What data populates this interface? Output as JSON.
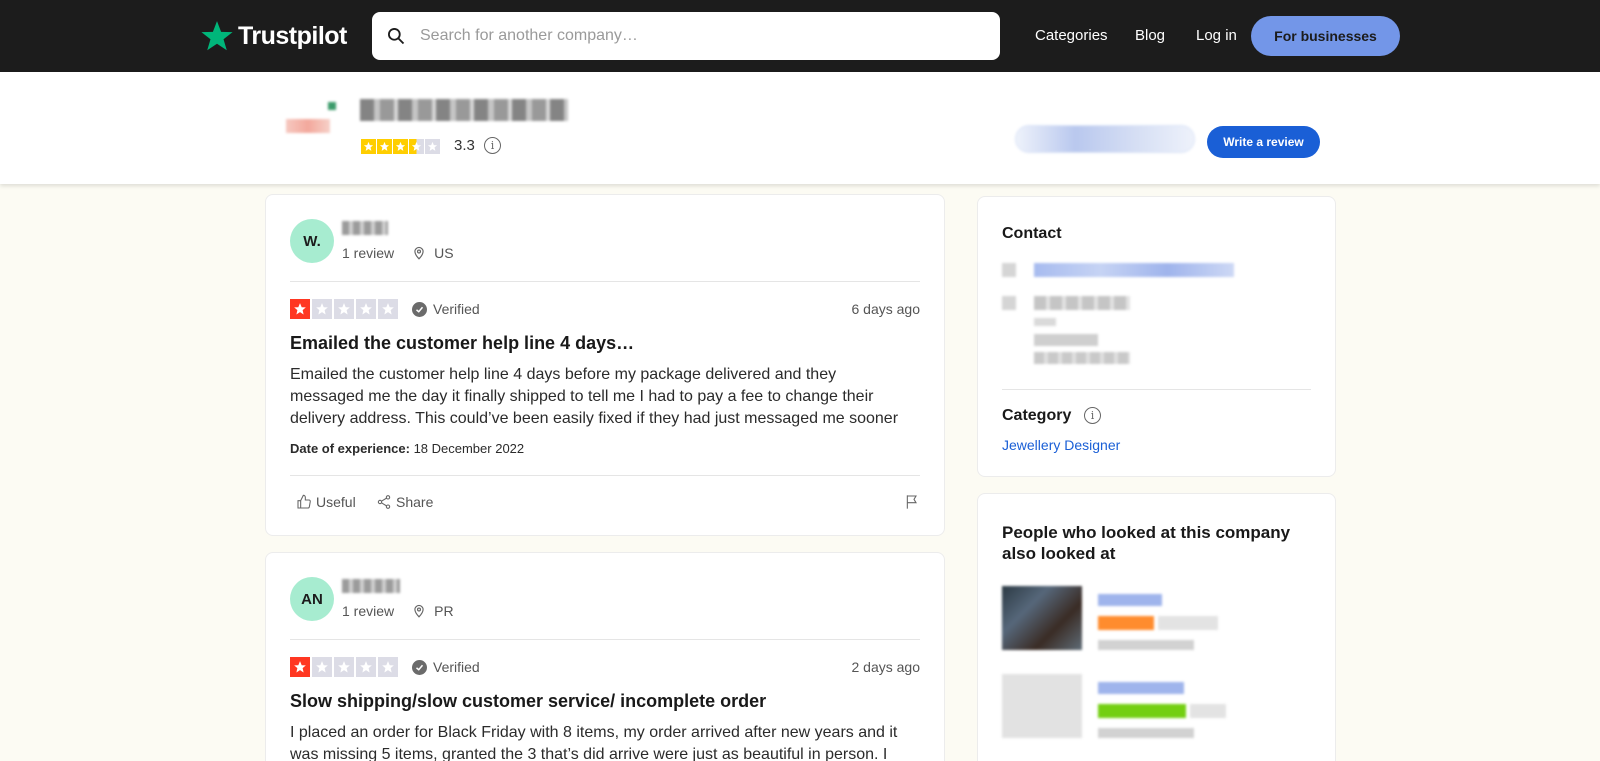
{
  "nav": {
    "logo_text": "Trustpilot",
    "search_placeholder": "Search for another company…",
    "links": [
      "Categories",
      "Blog",
      "Log in"
    ],
    "business_button": "For businesses"
  },
  "company": {
    "rating": "3.3",
    "rating_stars": 3.3,
    "write_review": "Write a review"
  },
  "reviews": [
    {
      "initials": "W.",
      "reviews_count": "1 review",
      "country": "US",
      "stars": 1,
      "verified": "Verified",
      "date_ago": "6 days ago",
      "title": "Emailed the customer help line 4 days…",
      "body": "Emailed the customer help line 4 days before my package delivered and they messaged me the day it finally shipped to tell me I had to pay a fee to change their delivery address. This could’ve been easily fixed if they had just messaged me sooner",
      "date_label": "Date of experience:",
      "date_value": "18 December 2022",
      "useful": "Useful",
      "share": "Share"
    },
    {
      "initials": "AN",
      "reviews_count": "1 review",
      "country": "PR",
      "stars": 1,
      "verified": "Verified",
      "date_ago": "2 days ago",
      "title": "Slow shipping/slow customer service/ incomplete order",
      "body": "I placed an order for Black Friday with 8 items, my order arrived after new years and it was missing 5 items, granted the 3 that’s did arrive were just as beautiful in person. I"
    }
  ],
  "sidebar": {
    "contact_title": "Contact",
    "category_title": "Category",
    "category_link": "Jewellery Designer",
    "also_looked_title": "People who looked at this company also looked at"
  },
  "colors": {
    "star_green": "#00b67a",
    "star_red": "#ff3722",
    "star_yellow": "#ffce00",
    "accent_blue": "#1a5fd6"
  }
}
